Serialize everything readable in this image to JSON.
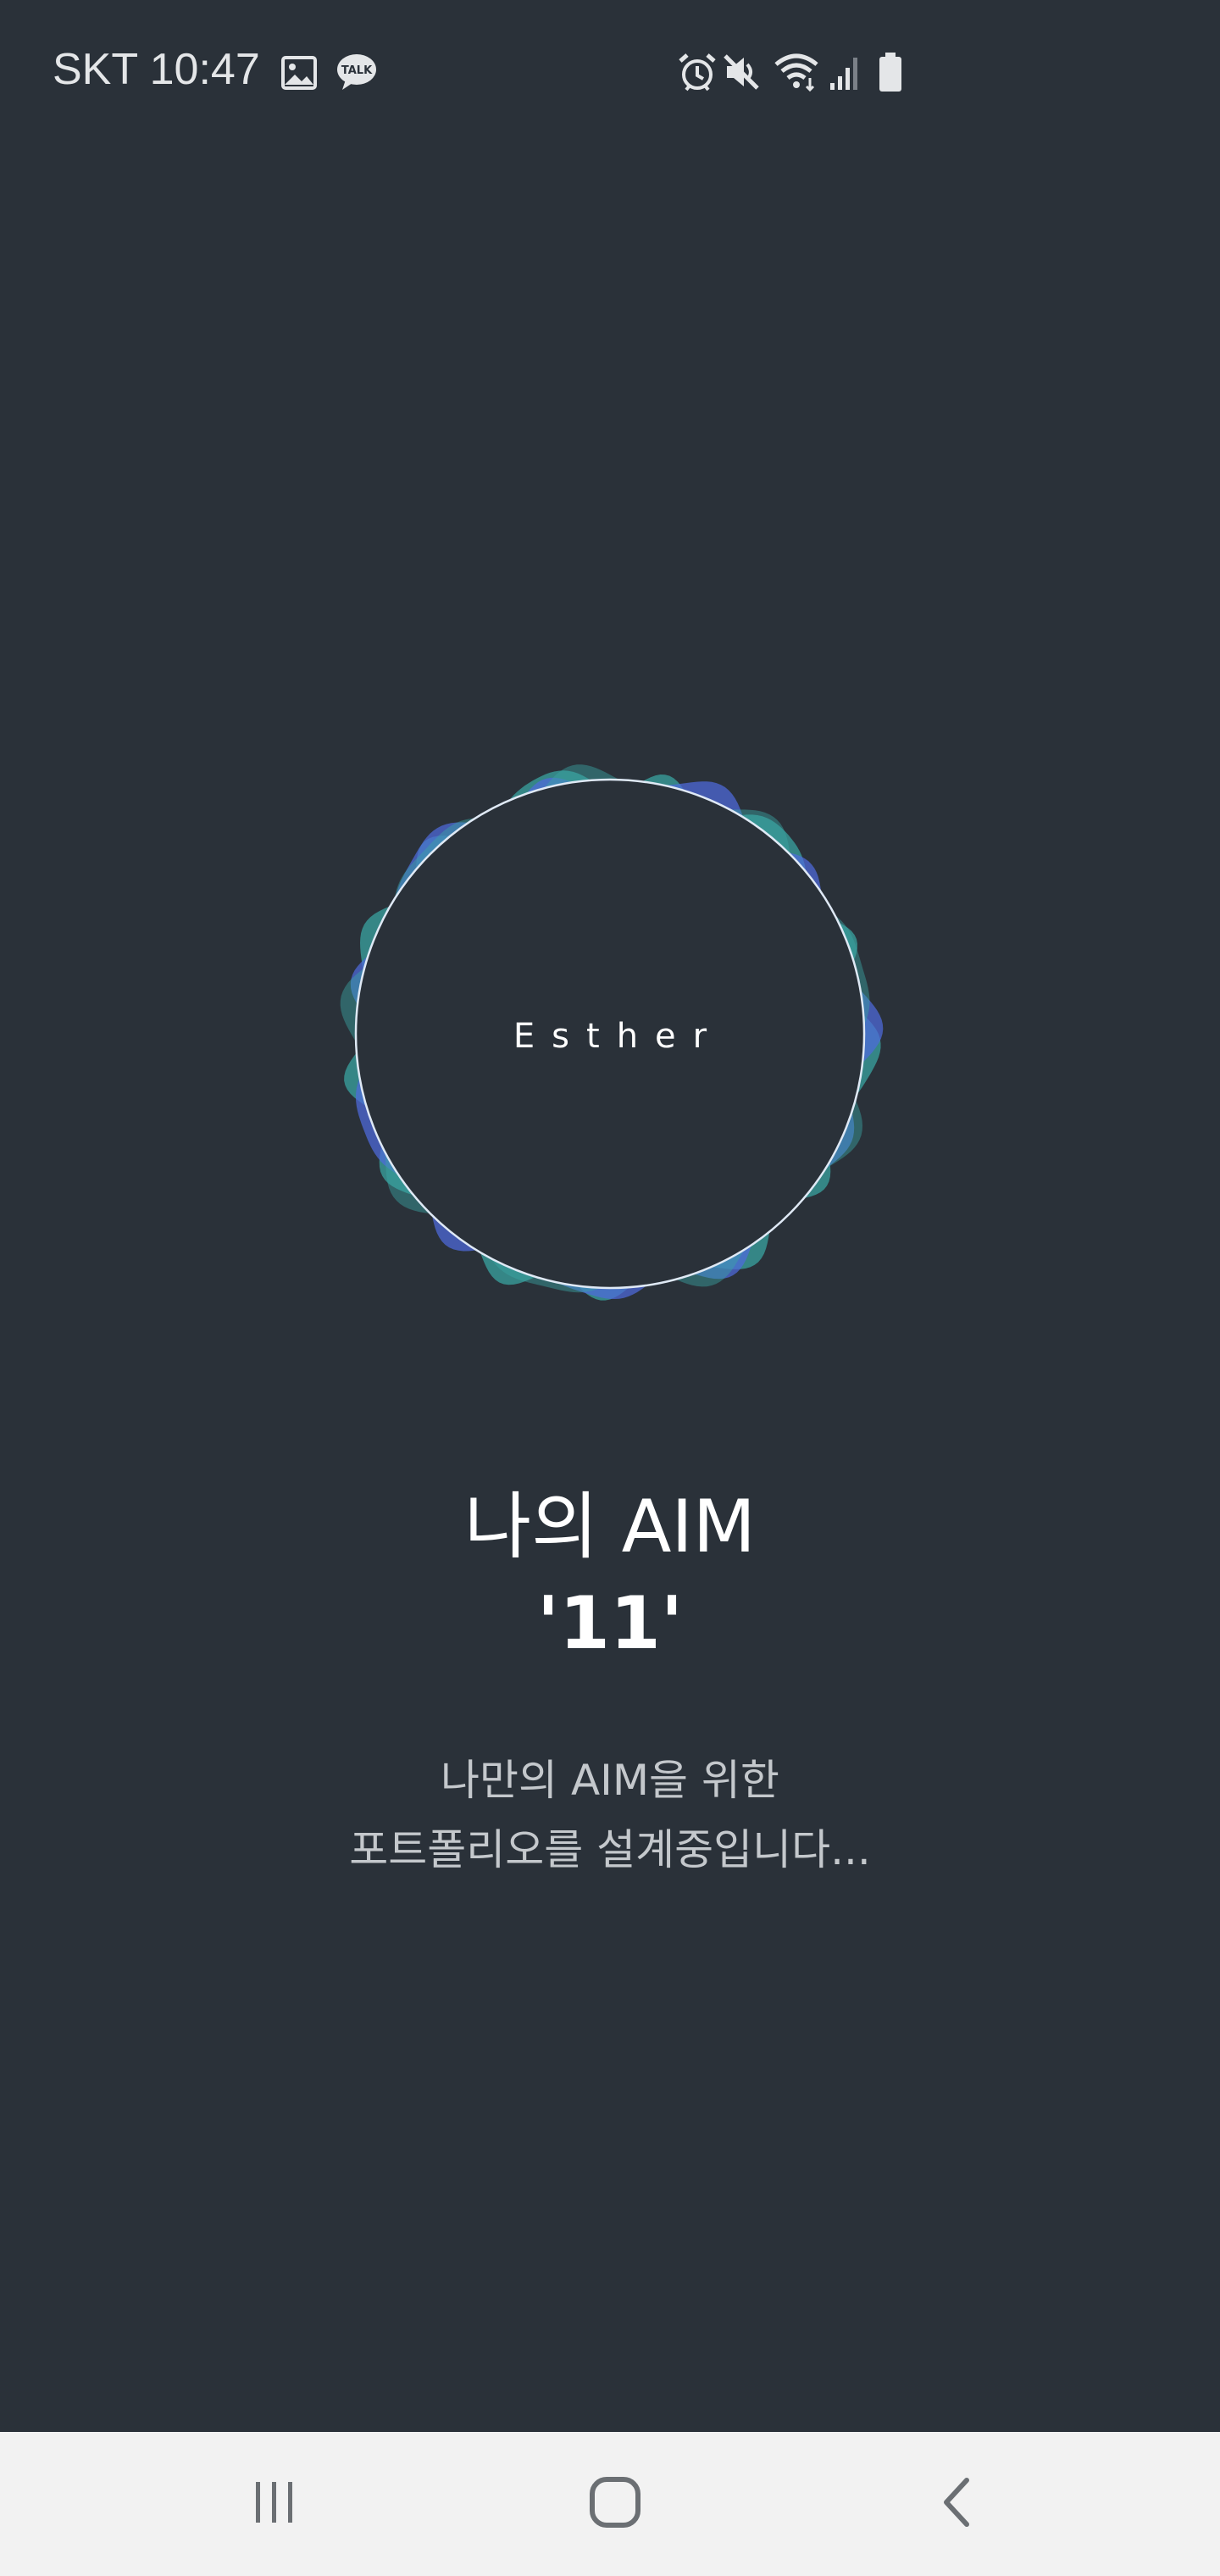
{
  "status_bar": {
    "carrier_time": "SKT 10:47",
    "icons": [
      "gallery-icon",
      "kakaotalk-icon",
      "alarm-icon",
      "mute-icon",
      "wifi-icon",
      "signal-icon",
      "battery-icon"
    ],
    "kakaotalk_label": "TALK"
  },
  "hero": {
    "user_name": "Esther",
    "colors": {
      "teal": "#3aa7a4",
      "blue": "#4f6bdc",
      "ring": "#dfe9f5"
    }
  },
  "aim": {
    "title": "나의 AIM",
    "value": "'11'"
  },
  "message": {
    "line1": "나만의 AIM을 위한",
    "line2": "포트폴리오를 설계중입니다..."
  },
  "nav": {
    "buttons": [
      "recent-apps-icon",
      "home-icon",
      "back-icon"
    ]
  },
  "theme": {
    "background": "#2a3139",
    "nav_background": "#f2f2f2"
  }
}
